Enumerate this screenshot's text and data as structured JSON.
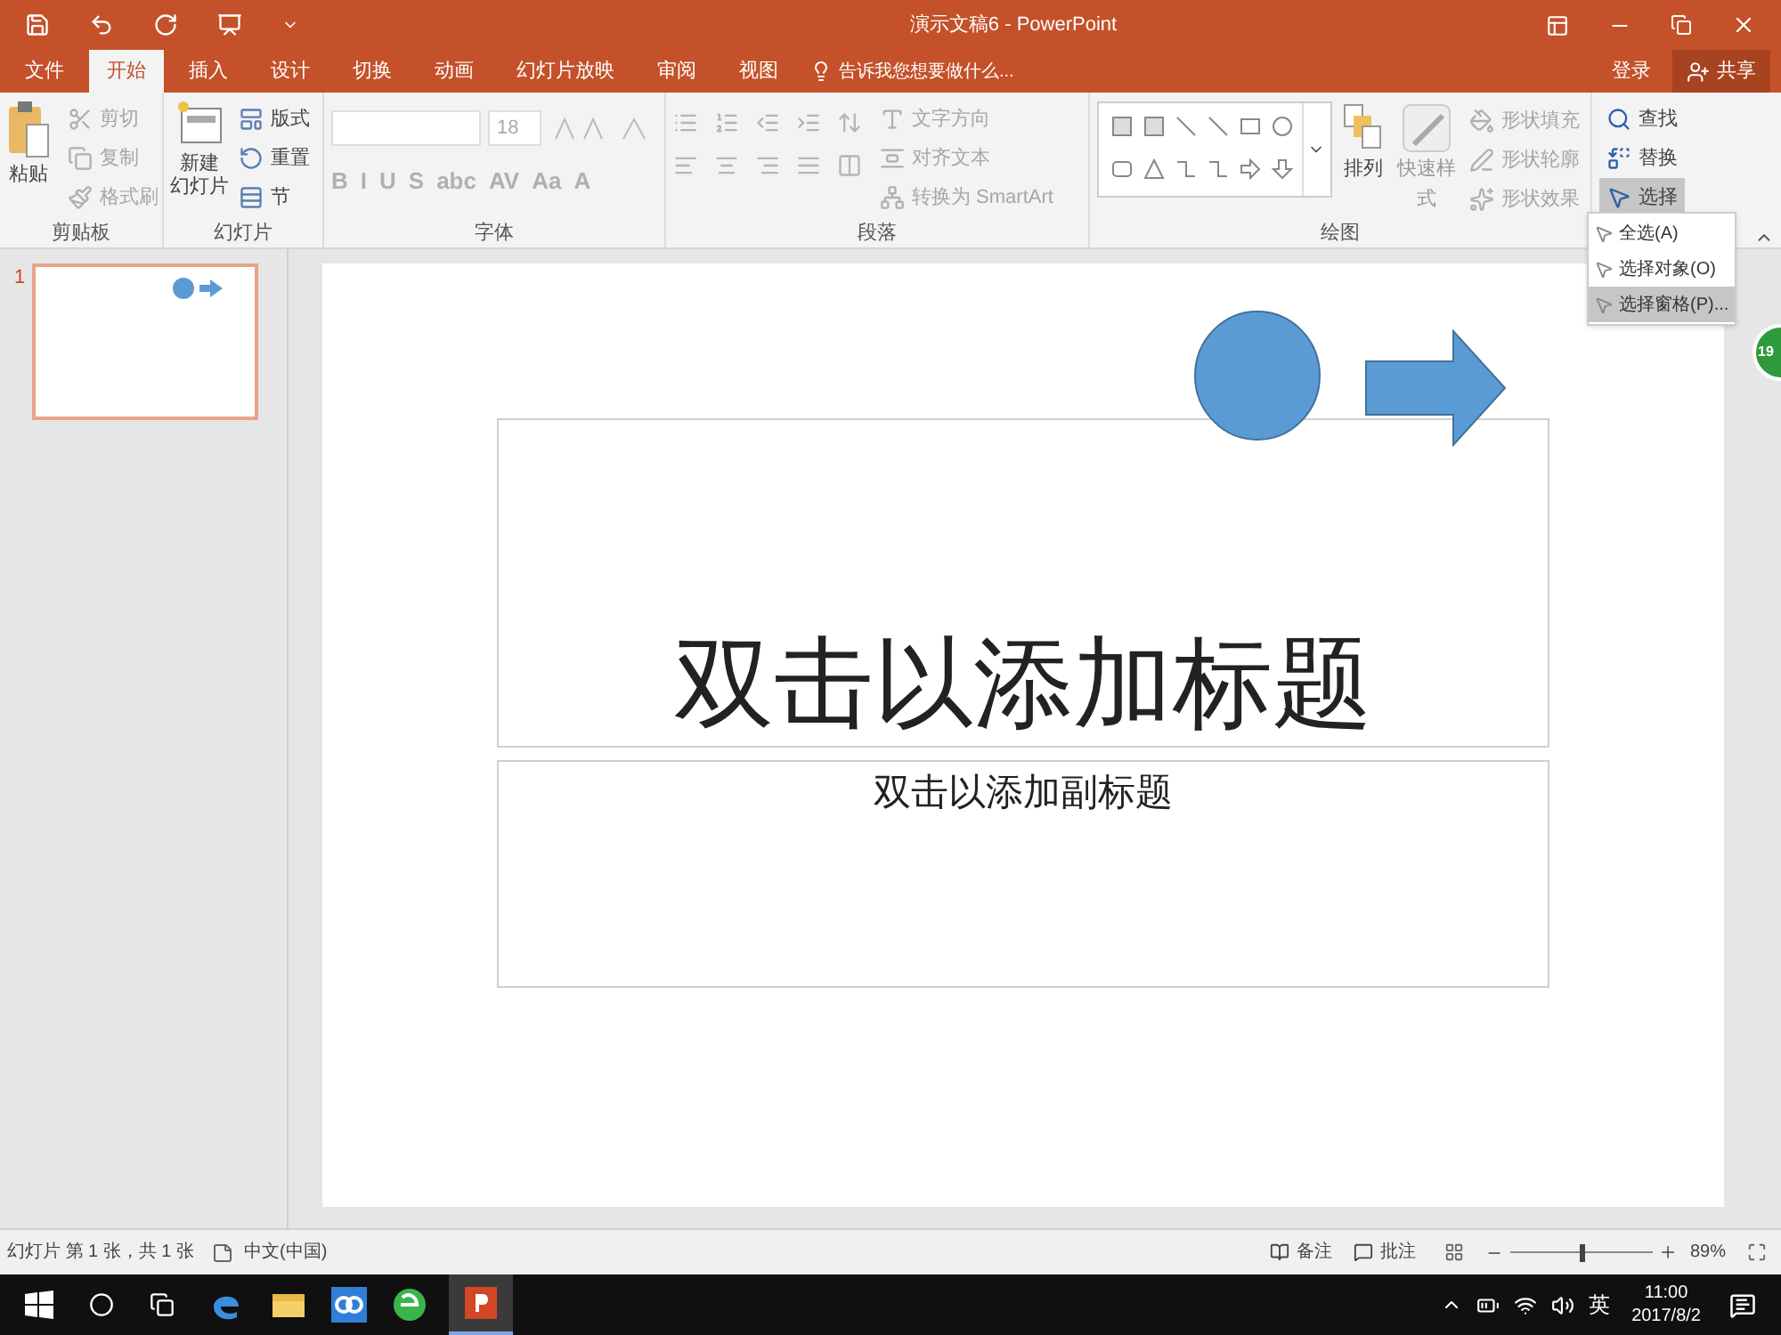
{
  "window": {
    "title": "演示文稿6 - PowerPoint"
  },
  "tabs": [
    {
      "label": "文件",
      "selected": false
    },
    {
      "label": "开始",
      "selected": true
    },
    {
      "label": "插入",
      "selected": false
    },
    {
      "label": "设计",
      "selected": false
    },
    {
      "label": "切换",
      "selected": false
    },
    {
      "label": "动画",
      "selected": false
    },
    {
      "label": "幻灯片放映",
      "selected": false
    },
    {
      "label": "审阅",
      "selected": false
    },
    {
      "label": "视图",
      "selected": false
    }
  ],
  "tell_me": "告诉我您想要做什么...",
  "account": {
    "sign_in": "登录",
    "share": "共享"
  },
  "ribbon": {
    "clipboard": {
      "label": "剪贴板",
      "paste": "粘贴",
      "items": [
        {
          "label": "剪切",
          "disabled": true
        },
        {
          "label": "复制",
          "disabled": true
        },
        {
          "label": "格式刷",
          "disabled": true
        }
      ]
    },
    "slides": {
      "label": "幻灯片",
      "new_slide": [
        "新建",
        "幻灯片"
      ],
      "items": [
        {
          "label": "版式",
          "disabled": false
        },
        {
          "label": "重置",
          "disabled": false
        },
        {
          "label": "节",
          "disabled": false
        }
      ]
    },
    "font": {
      "label": "字体",
      "size": "18",
      "buttons": [
        "B",
        "I",
        "U",
        "S",
        "abc",
        "AV",
        "Aa",
        "A"
      ]
    },
    "paragraph": {
      "label": "段落",
      "items": [
        {
          "label": "文字方向",
          "disabled": true
        },
        {
          "label": "对齐文本",
          "disabled": true
        },
        {
          "label": "转换为 SmartArt",
          "disabled": true
        }
      ]
    },
    "drawing": {
      "label": "绘图",
      "arrange": "排列",
      "quick_styles": "快速样式",
      "items": [
        {
          "label": "形状填充",
          "disabled": true
        },
        {
          "label": "形状轮廓",
          "disabled": true
        },
        {
          "label": "形状效果",
          "disabled": true
        }
      ]
    },
    "editing": {
      "items": [
        {
          "label": "查找",
          "selected": false
        },
        {
          "label": "替换",
          "selected": false
        },
        {
          "label": "选择",
          "selected": true
        }
      ]
    }
  },
  "select_menu": [
    {
      "label": "全选(A)",
      "selected": false
    },
    {
      "label": "选择对象(O)",
      "selected": false
    },
    {
      "label": "选择窗格(P)...",
      "selected": true
    }
  ],
  "thumbnails": [
    {
      "number": "1",
      "selected": true
    }
  ],
  "slide": {
    "title": "双击以添加标题",
    "subtitle": "双击以添加副标题"
  },
  "floating_badge": "19",
  "status_bar": {
    "slide_info": "幻灯片 第 1 张，共 1 张",
    "language": "中文(中国)",
    "notes": "备注",
    "comments": "批注",
    "zoom": {
      "level": 0.5
    },
    "zoom_text": "89%"
  },
  "taskbar": {
    "ime": "英",
    "time": "11:00",
    "date": "2017/8/2"
  }
}
